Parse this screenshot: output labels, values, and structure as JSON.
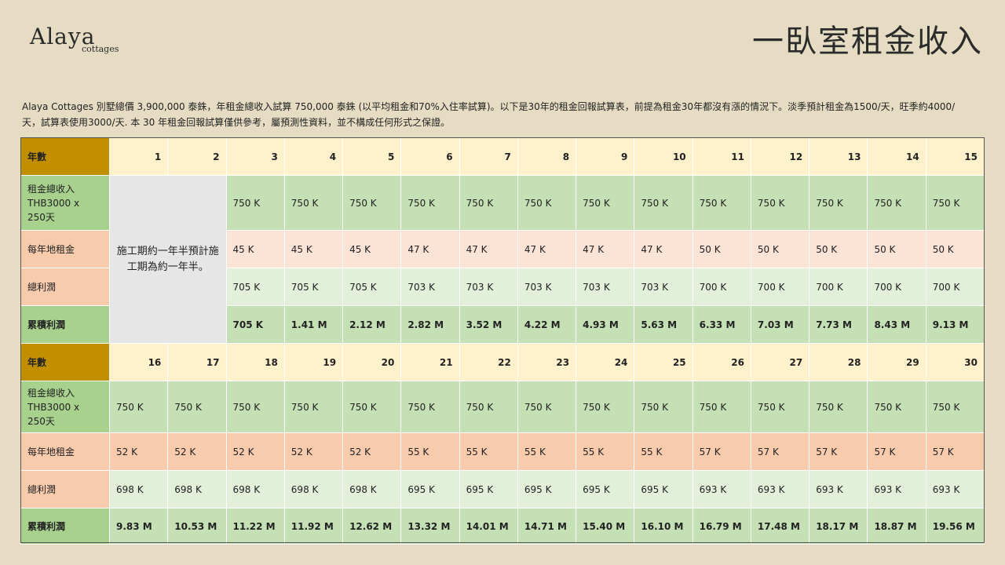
{
  "header": {
    "logo_main": "Alaya",
    "logo_sub": "cottages",
    "title": "一臥室租金收入"
  },
  "intro": "Alaya Cottages 別墅總價 3,900,000 泰銖，年租金總收入試算 750,000 泰銖 (以平均租金和70%入住率試算)。以下是30年的租金回報試算表，前提為租金30年都沒有漲的情況下。淡季預計租金為1500/天，旺季約4000/天，試算表使用3000/天. 本 30 年租金回報試算僅供參考，屬預測性資料，並不構成任何形式之保證。",
  "table": {
    "labels": {
      "year": "年數",
      "income_line1": "租金總收入",
      "income_line2": "THB3000 x",
      "income_line3": "250天",
      "land": "每年地租金",
      "profit": "總利潤",
      "cumulative": "累積利潤"
    },
    "construction_note": "施工期約一年半預計施工期為約一年半。",
    "block1": {
      "years": [
        "1",
        "2",
        "3",
        "4",
        "5",
        "6",
        "7",
        "8",
        "9",
        "10",
        "11",
        "12",
        "13",
        "14",
        "15"
      ],
      "income": [
        "750 K",
        "750 K",
        "750 K",
        "750 K",
        "750 K",
        "750 K",
        "750 K",
        "750 K",
        "750 K",
        "750 K",
        "750 K",
        "750 K",
        "750 K"
      ],
      "land": [
        "45 K",
        "45 K",
        "45 K",
        "47 K",
        "47 K",
        "47 K",
        "47 K",
        "47 K",
        "50 K",
        "50 K",
        "50 K",
        "50 K",
        "50 K"
      ],
      "profit": [
        "705 K",
        "705 K",
        "705 K",
        "703 K",
        "703 K",
        "703 K",
        "703 K",
        "703 K",
        "700 K",
        "700 K",
        "700 K",
        "700 K",
        "700 K"
      ],
      "cumulative": [
        "705 K",
        "1.41 M",
        "2.12 M",
        "2.82 M",
        "3.52 M",
        "4.22 M",
        "4.93 M",
        "5.63 M",
        "6.33 M",
        "7.03 M",
        "7.73 M",
        "8.43 M",
        "9.13 M"
      ]
    },
    "block2": {
      "years": [
        "16",
        "17",
        "18",
        "19",
        "20",
        "21",
        "22",
        "23",
        "24",
        "25",
        "26",
        "27",
        "28",
        "29",
        "30"
      ],
      "income": [
        "750 K",
        "750 K",
        "750 K",
        "750 K",
        "750 K",
        "750 K",
        "750 K",
        "750 K",
        "750 K",
        "750 K",
        "750 K",
        "750 K",
        "750 K",
        "750 K",
        "750 K"
      ],
      "land": [
        "52 K",
        "52 K",
        "52 K",
        "52 K",
        "52 K",
        "55 K",
        "55 K",
        "55 K",
        "55 K",
        "55 K",
        "57 K",
        "57 K",
        "57 K",
        "57 K",
        "57 K"
      ],
      "profit": [
        "698 K",
        "698 K",
        "698 K",
        "698 K",
        "698 K",
        "695 K",
        "695 K",
        "695 K",
        "695 K",
        "695 K",
        "693 K",
        "693 K",
        "693 K",
        "693 K",
        "693 K"
      ],
      "cumulative": [
        "9.83 M",
        "10.53 M",
        "11.22 M",
        "11.92 M",
        "12.62 M",
        "13.32 M",
        "14.01 M",
        "14.71 M",
        "15.40 M",
        "16.10 M",
        "16.79 M",
        "17.48 M",
        "18.17 M",
        "18.87 M",
        "19.56 M"
      ]
    }
  }
}
